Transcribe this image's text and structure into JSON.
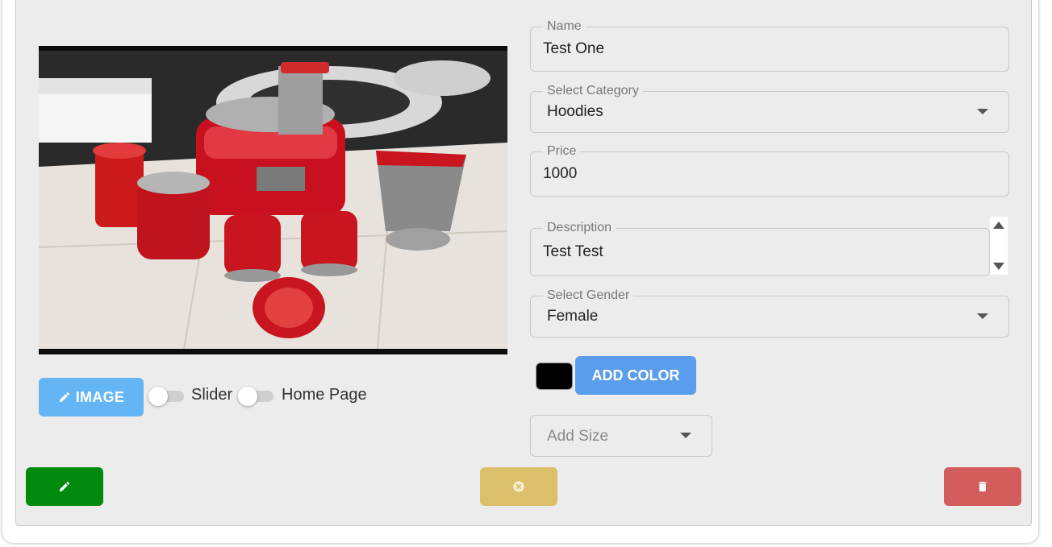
{
  "form": {
    "name": {
      "label": "Name",
      "value": "Test One"
    },
    "category": {
      "label": "Select Category",
      "value": "Hoodies"
    },
    "price": {
      "label": "Price",
      "value": "1000"
    },
    "description": {
      "label": "Description",
      "value": "Test Test"
    },
    "gender": {
      "label": "Select Gender",
      "value": "Female"
    },
    "size": {
      "placeholder": "Add Size"
    },
    "color": {
      "button_label": "ADD COLOR",
      "selected": "#000000"
    }
  },
  "media": {
    "image_button_label": "IMAGE",
    "toggles": [
      {
        "label": "Slider",
        "on": false
      },
      {
        "label": "Home Page",
        "on": false
      }
    ]
  },
  "actions": {
    "edit_icon": "pencil-icon",
    "cancel_icon": "close-circle-icon",
    "delete_icon": "trash-icon"
  },
  "colors": {
    "image_button": "#64b5f6",
    "add_color_button": "#5b9ded",
    "edit_button": "#028a0f",
    "cancel_button": "#dcbf6a",
    "delete_button": "#d35d5d"
  }
}
